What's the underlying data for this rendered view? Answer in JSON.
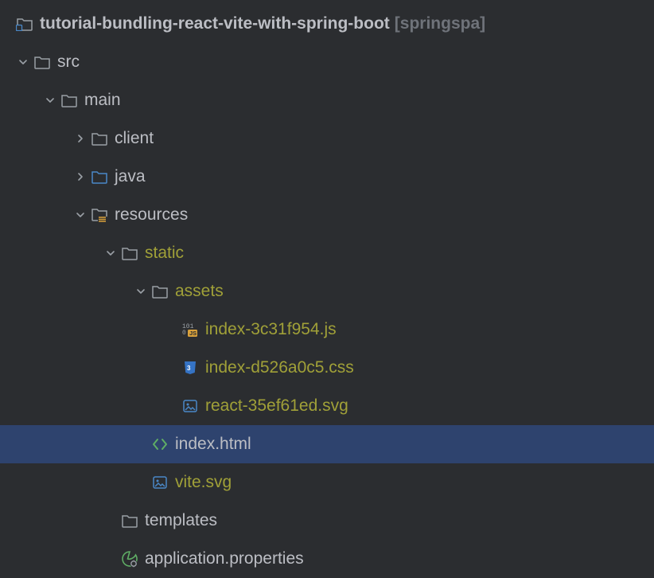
{
  "root": {
    "name": "tutorial-bundling-react-vite-with-spring-boot",
    "suffix": "[springspa]"
  },
  "tree": {
    "src": "src",
    "main": "main",
    "client": "client",
    "java": "java",
    "resources": "resources",
    "static": "static",
    "assets": "assets",
    "files": {
      "indexJs": "index-3c31f954.js",
      "indexCss": "index-d526a0c5.css",
      "reactSvg": "react-35ef61ed.svg",
      "indexHtml": "index.html",
      "viteSvg": "vite.svg",
      "templates": "templates",
      "appProps": "application.properties"
    }
  },
  "indent": {
    "l0": 18,
    "l1": 18,
    "l2": 52,
    "l3": 90,
    "l4": 128,
    "l5": 166,
    "l6": 204,
    "leaf6": 226,
    "leaf5": 188,
    "leaf4": 150
  }
}
